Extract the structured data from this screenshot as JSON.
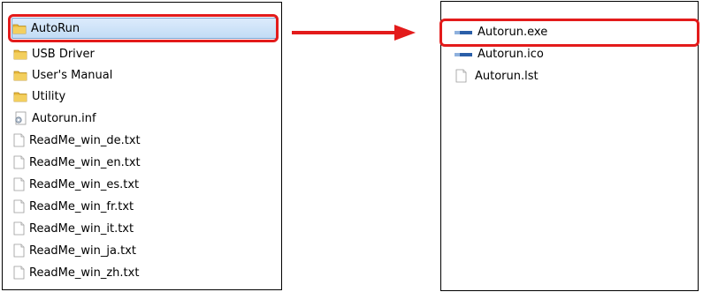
{
  "left_pane": {
    "items": [
      {
        "label": "AutoRun",
        "icon": "folder-icon",
        "selected": true
      },
      {
        "label": "USB Driver",
        "icon": "folder-icon"
      },
      {
        "label": "User's Manual",
        "icon": "folder-icon"
      },
      {
        "label": "Utility",
        "icon": "folder-icon"
      },
      {
        "label": "Autorun.inf",
        "icon": "settings-file-icon"
      },
      {
        "label": "ReadMe_win_de.txt",
        "icon": "text-file-icon"
      },
      {
        "label": "ReadMe_win_en.txt",
        "icon": "text-file-icon"
      },
      {
        "label": "ReadMe_win_es.txt",
        "icon": "text-file-icon"
      },
      {
        "label": "ReadMe_win_fr.txt",
        "icon": "text-file-icon"
      },
      {
        "label": "ReadMe_win_it.txt",
        "icon": "text-file-icon"
      },
      {
        "label": "ReadMe_win_ja.txt",
        "icon": "text-file-icon"
      },
      {
        "label": "ReadMe_win_zh.txt",
        "icon": "text-file-icon"
      }
    ]
  },
  "right_pane": {
    "items": [
      {
        "label": "Autorun.exe",
        "icon": "application-icon"
      },
      {
        "label": "Autorun.ico",
        "icon": "application-icon"
      },
      {
        "label": "Autorun.lst",
        "icon": "text-file-icon"
      }
    ]
  },
  "colors": {
    "highlight": "#e31b1b",
    "arrow": "#e31b1b",
    "folder": "#e8b83a",
    "selection": "#cfe4fa"
  }
}
